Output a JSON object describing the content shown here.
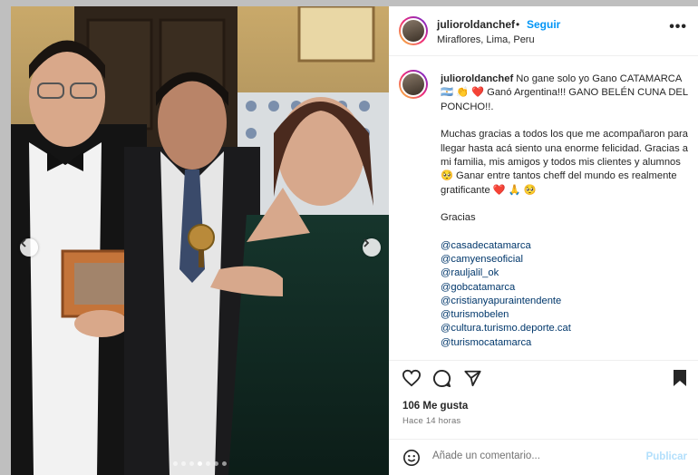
{
  "post": {
    "username": "julioroldanchef",
    "separator": "•",
    "follow_label": "Seguir",
    "location": "Miraflores, Lima, Peru",
    "more_icon": "more-options-icon",
    "more_label": "•••"
  },
  "caption": {
    "username": "julioroldanchef",
    "line1": "No gane solo yo Gano CATAMARCA 🇦🇷 👏 ❤️  Ganó Argentina!!! GANO BELÉN CUNA DEL PONCHO!!.",
    "paragraph2": "Muchas gracias a todos los que me acompañaron para llegar hasta acá siento una enorme felicidad. Gracias a mi familia, mis amigos y todos mis clientes y alumnos 🥺  Ganar entre tantos cheff del mundo es realmente gratificante ❤️ 🙏 🥺",
    "gracias": "Gracias",
    "tags": [
      "@casadecatamarca",
      "@camyenseoficial",
      "@rauljalil_ok",
      "@gobcatamarca",
      "@cristianyapuraintendente",
      "@turismobelen",
      "@cultura.turismo.deporte.cat",
      "@turismocatamarca"
    ]
  },
  "engagement": {
    "likes": "106 Me gusta",
    "time": "Hace 14 horas"
  },
  "comment": {
    "placeholder": "Añade un comentario...",
    "publish_label": "Publicar"
  },
  "carousel": {
    "total": 7,
    "active_index": 3
  },
  "colors": {
    "link": "#0095f6",
    "tag": "#00376b",
    "publish_disabled": "#b2dffc"
  }
}
